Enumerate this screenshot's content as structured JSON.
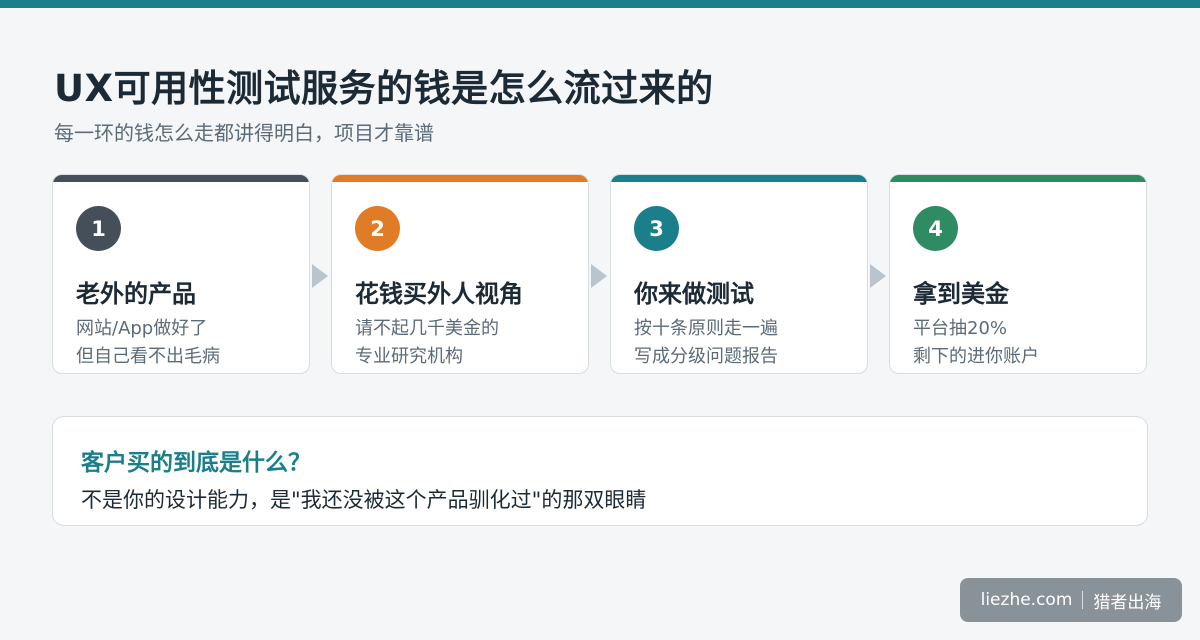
{
  "header": {
    "title": "UX可用性测试服务的钱是怎么流过来的",
    "subtitle": "每一环的钱怎么走都讲得明白，项目才靠谱",
    "top_bar_color": "#1a7f8a"
  },
  "steps": [
    {
      "number": "1",
      "title": "老外的产品",
      "line1": "网站/App做好了",
      "line2": "但自己看不出毛病",
      "color": "#444f5a"
    },
    {
      "number": "2",
      "title": "花钱买外人视角",
      "line1": "请不起几千美金的",
      "line2": "专业研究机构",
      "color": "#e07b26"
    },
    {
      "number": "3",
      "title": "你来做测试",
      "line1": "按十条原则走一遍",
      "line2": "写成分级问题报告",
      "color": "#1a7f8a"
    },
    {
      "number": "4",
      "title": "拿到美金",
      "line1": "平台抽20%",
      "line2": "剩下的进你账户",
      "color": "#2e8b62"
    }
  ],
  "insight": {
    "question": "客户买的到底是什么？",
    "answer": "不是你的设计能力，是\"我还没被这个产品驯化过\"的那双眼睛"
  },
  "brand": {
    "domain": "liezhe.com",
    "name": "猎者出海"
  }
}
